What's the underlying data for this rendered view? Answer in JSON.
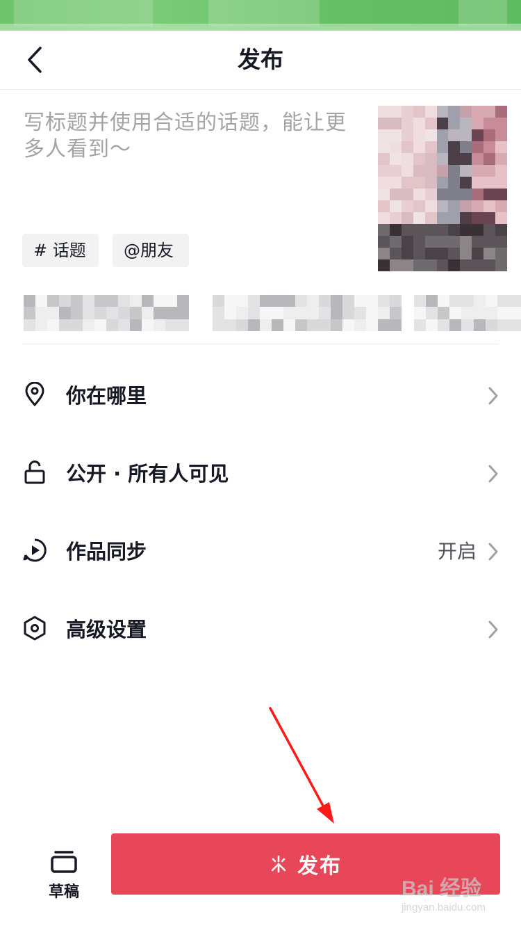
{
  "header": {
    "title": "发布"
  },
  "caption": {
    "placeholder": "写标题并使用合适的话题，能让更多人看到～"
  },
  "chips": [
    {
      "label": "# 话题"
    },
    {
      "label": "@朋友"
    }
  ],
  "menu": [
    {
      "icon": "location-pin-icon",
      "label": "你在哪里",
      "value": ""
    },
    {
      "icon": "unlock-icon",
      "label": "公开 · 所有人可见",
      "value": ""
    },
    {
      "icon": "sync-play-icon",
      "label": "作品同步",
      "value": "开启"
    },
    {
      "icon": "hexagon-settings-icon",
      "label": "高级设置",
      "value": ""
    }
  ],
  "bottom": {
    "drafts_label": "草稿",
    "publish_label": "发布"
  },
  "watermark": {
    "main": "Bai 经验",
    "sub": "jingyan.baidu.com"
  },
  "colors": {
    "accent": "#e8475a",
    "status_bar": "#6cc36b",
    "annotation_arrow": "#ff1a1a"
  }
}
